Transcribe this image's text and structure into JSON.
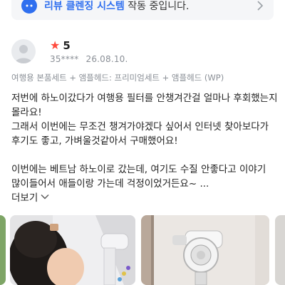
{
  "banner": {
    "icon": "review-cleaning-icon",
    "accent_color": "#2f6fef",
    "highlight": "리뷰 클렌징 시스템",
    "suffix": " 작동 중입니다."
  },
  "review": {
    "rating_icon": "star-icon",
    "rating_color": "#ff4a3d",
    "rating": "5",
    "reviewer": "35****",
    "date": "26.08.10.",
    "options": "여행용 본품세트 + 앰플헤드: 프리미엄세트 + 앰플헤드 (WP)",
    "body_lines_1": [
      "저번에 하노이갔다가 여행용 필터를 안챙겨간걸 얼마나 후회했는지",
      "몰라요!",
      "그래서 이번에는 무조건 챙겨가야겠다 싶어서 인터넷 찾아보다가",
      "후기도 좋고, 가벼울것같아서 구매했어요!"
    ],
    "body_lines_2": [
      "이번에는 베트남 하노이로 갔는데, 여기도 수질 안좋다고 이야기",
      "많이들어서 애들이랑 가는데 걱정이었거든요~ ..."
    ],
    "more_label": "더보기"
  },
  "photos": [
    {
      "alt": "partial photo"
    },
    {
      "alt": "child holding shower head"
    },
    {
      "alt": "shower filter on wall"
    },
    {
      "alt": "partial photo"
    }
  ]
}
